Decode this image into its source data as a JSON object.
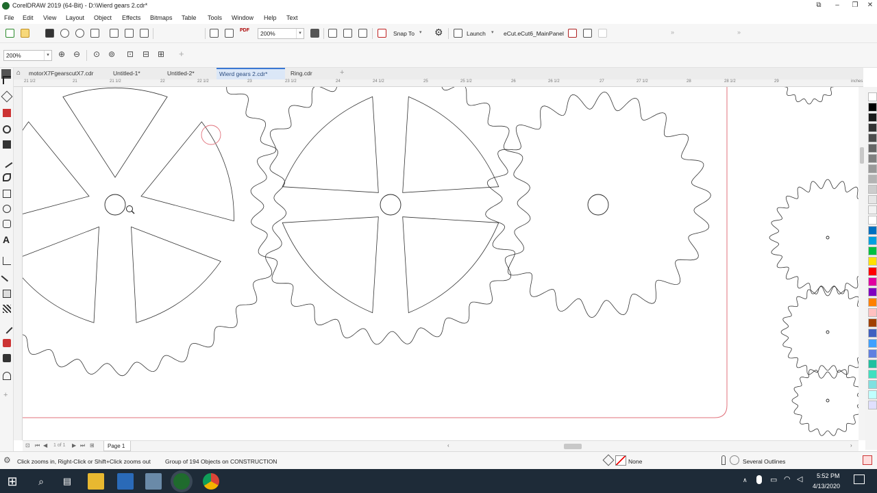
{
  "window": {
    "title": "CorelDRAW 2019 (64-Bit) - D:\\Wierd gears 2.cdr*"
  },
  "menu": [
    "File",
    "Edit",
    "View",
    "Layout",
    "Object",
    "Effects",
    "Bitmaps",
    "Table",
    "Tools",
    "Window",
    "Help",
    "Text"
  ],
  "toolbar": {
    "zoom_value": "200%",
    "snap_to_label": "Snap To",
    "launch_label": "Launch",
    "panel_label": "eCut.eCut6_MainPanel"
  },
  "property_bar": {
    "zoom_value": "200%"
  },
  "tabs": [
    {
      "label": "motorX7FgearscutX7.cdr",
      "active": false
    },
    {
      "label": "Untitled-1*",
      "active": false
    },
    {
      "label": "Untitled-2*",
      "active": false
    },
    {
      "label": "Wierd gears 2.cdr*",
      "active": true
    },
    {
      "label": "Ring.cdr",
      "active": false
    }
  ],
  "ruler": {
    "units": "inches",
    "top_ticks": [
      "21 1/2",
      "21",
      "21 1/2",
      "22",
      "22 1/2",
      "23",
      "23 1/2",
      "24",
      "24 1/2",
      "25",
      "25 1/2",
      "26",
      "26 1/2",
      "27",
      "27 1/2",
      "28",
      "28 1/2",
      "29"
    ]
  },
  "page_nav": {
    "page_of": "1 of 1",
    "page_tab": "Page 1"
  },
  "status": {
    "hint": "Click zooms in, Right-Click or Shift+Click zooms out",
    "selection": "Group of 194 Objects on CONSTRUCTION",
    "fill": "None",
    "outline": "Several Outlines"
  },
  "taskbar": {
    "time": "5:52 PM",
    "date": "4/13/2020"
  },
  "palette_colors": [
    "#ffffff",
    "#000000",
    "#1a1a1a",
    "#333333",
    "#4d4d4d",
    "#666666",
    "#808080",
    "#999999",
    "#b3b3b3",
    "#cccccc",
    "#e6e6e6",
    "#f2f2f2",
    "#ffffff",
    "#0070c0",
    "#00a0e0",
    "#00c040",
    "#ffe000",
    "#ff0000",
    "#e000a0",
    "#8000c0",
    "#ff8000",
    "#ffc0c0",
    "#a04000",
    "#4060c0",
    "#40a0ff",
    "#6080e0",
    "#20c0a0",
    "#40e0c0",
    "#80e0e0",
    "#c0ffff",
    "#e0e0ff"
  ]
}
